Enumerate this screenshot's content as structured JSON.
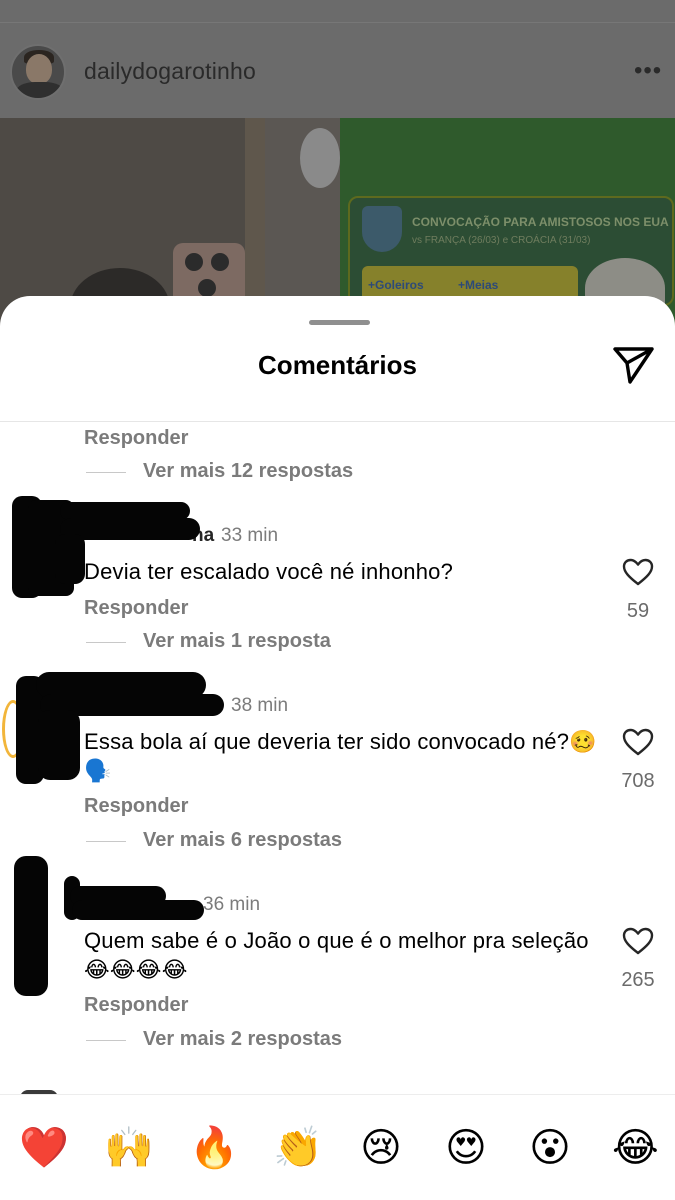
{
  "post": {
    "username": "dailydogarotinho",
    "more_label": "•••",
    "card_title": "CONVOCAÇÃO PARA AMISTOSOS NOS EUA",
    "card_subtitle": "vs FRANÇA (26/03) e CROÁCIA (31/03)",
    "positions": [
      "+Goleiros",
      "+Meias"
    ]
  },
  "sheet": {
    "title": "Comentários"
  },
  "prev_thread": {
    "reply_label": "Responder",
    "more_replies": "Ver mais 12 respostas"
  },
  "comments": [
    {
      "user_visible": "na",
      "time": "33 min",
      "text": "Devia ter escalado você né inhonho?",
      "likes": "59",
      "reply_label": "Responder",
      "more_replies": "Ver mais 1 resposta"
    },
    {
      "time": "38 min",
      "text": "Essa bola aí que deveria ter sido convocado né?🥴 🗣️",
      "likes": "708",
      "reply_label": "Responder",
      "more_replies": "Ver mais 6 respostas"
    },
    {
      "time": "36 min",
      "text": "Quem sabe é o João o que é o melhor pra seleção 😂😂😂😂",
      "likes": "265",
      "reply_label": "Responder",
      "more_replies": "Ver mais 2 respostas"
    }
  ],
  "reactions": [
    {
      "name": "red-heart",
      "glyph": "❤️"
    },
    {
      "name": "raising-hands",
      "glyph": "🙌"
    },
    {
      "name": "fire",
      "glyph": "🔥"
    },
    {
      "name": "clapping-hands",
      "glyph": "👏"
    },
    {
      "name": "crying-face",
      "glyph": "😢"
    },
    {
      "name": "heart-eyes",
      "glyph": "😍"
    },
    {
      "name": "surprised-face",
      "glyph": "😮"
    },
    {
      "name": "tears-of-joy",
      "glyph": "😂"
    }
  ],
  "colors": {
    "sheet_bg": "#ffffff",
    "muted_text": "#7b7b7b",
    "overlay_dim": "#5a5a5a"
  },
  "icons": {
    "share": "paper-plane-icon",
    "like": "heart-outline-icon",
    "more": "more-horizontal-icon"
  }
}
